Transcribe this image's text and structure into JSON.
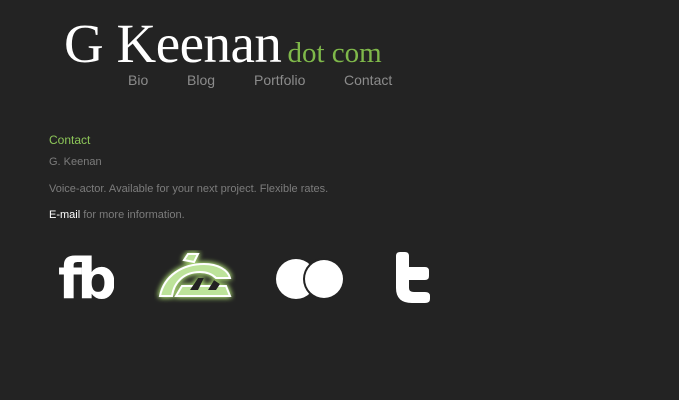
{
  "header": {
    "title_main": "G Keenan",
    "title_sub": "dot com"
  },
  "nav": {
    "items": [
      {
        "label": "Bio"
      },
      {
        "label": "Blog"
      },
      {
        "label": "Portfolio"
      },
      {
        "label": "Contact"
      }
    ]
  },
  "contact": {
    "heading": "Contact",
    "name": "G. Keenan",
    "description": "Voice-actor. Available for your next project. Flexible rates.",
    "email_link": "E-mail",
    "email_suffix": " for more information."
  },
  "social": {
    "facebook": {
      "icon": "facebook-icon",
      "glyph": "fb"
    },
    "deviantart": {
      "icon": "deviantart-icon"
    },
    "flickr": {
      "icon": "flickr-icon"
    },
    "twitter": {
      "icon": "twitter-icon"
    }
  },
  "colors": {
    "background": "#232323",
    "accent": "#8dc659",
    "nav_text": "#8c8c8c",
    "body_text": "#7c7c7c",
    "white": "#ffffff"
  }
}
